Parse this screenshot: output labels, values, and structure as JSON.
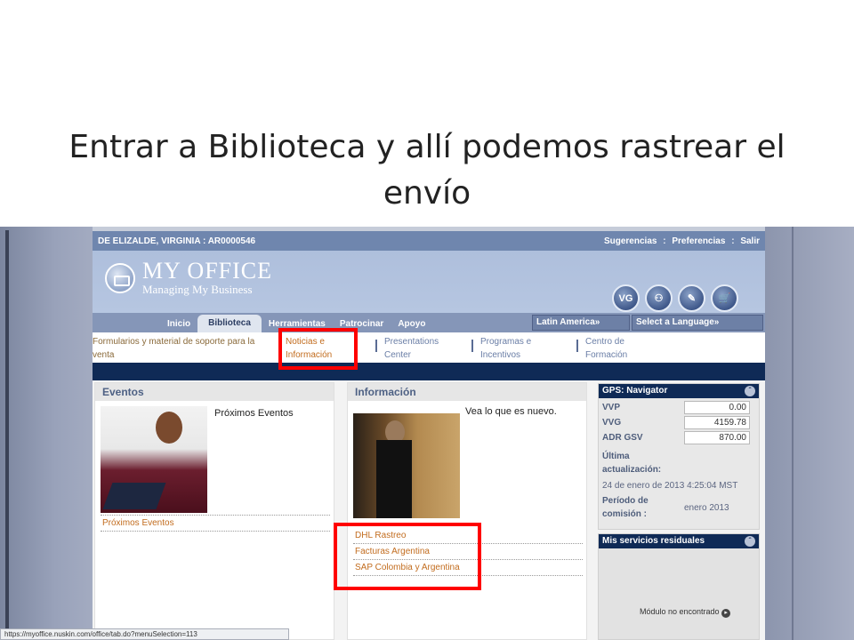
{
  "slide": {
    "title": "Entrar a Biblioteca y allí podemos rastrear el envío"
  },
  "topbar": {
    "user": "DE ELIZALDE, VIRGINIA  :  AR0000546",
    "links": [
      "Sugerencias",
      ":",
      "Preferencias",
      ":",
      "Salir"
    ]
  },
  "brand": {
    "line1": "MY OFFICE",
    "line2": "Managing My Business"
  },
  "header_icons": [
    {
      "name": "vg-icon",
      "label": "VG"
    },
    {
      "name": "people-icon",
      "label": ""
    },
    {
      "name": "tools-icon",
      "label": ""
    },
    {
      "name": "cart-icon",
      "label": ""
    }
  ],
  "nav": {
    "tabs": [
      "Inicio",
      "Biblioteca",
      "Herramientas",
      "Patrocinar",
      "Apoyo"
    ],
    "active": "Biblioteca",
    "region_select": "Latin America»",
    "language_select": "Select a Language»"
  },
  "subnav": {
    "items": [
      {
        "l1": "Formularios y material de soporte para la",
        "l2": "venta"
      },
      {
        "l1": "Noticias e",
        "l2": "Información"
      },
      {
        "l1": "Presentations",
        "l2": "Center"
      },
      {
        "l1": "Programas e",
        "l2": "Incentivos"
      },
      {
        "l1": "Centro de",
        "l2": "Formación"
      }
    ]
  },
  "eventos": {
    "header": "Eventos",
    "caption": "Próximos Eventos",
    "link": "Próximos Eventos"
  },
  "informacion": {
    "header": "Información",
    "caption": "Vea lo que es nuevo.",
    "links": [
      "DHL Rastreo",
      "Facturas Argentina",
      "SAP Colombia y Argentina"
    ]
  },
  "gps": {
    "header": "GPS: Navigator",
    "rows": [
      {
        "label": "VVP",
        "value": "0.00"
      },
      {
        "label": "VVG",
        "value": "4159.78"
      },
      {
        "label": "ADR GSV",
        "value": "870.00"
      }
    ],
    "updated_label_1": "Última",
    "updated_label_2": "actualización:",
    "updated_value": "24 de enero de 2013 4:25:04 MST",
    "period_label_1": "Período de",
    "period_label_2": "comisión :",
    "period_value": "enero 2013"
  },
  "residuales": {
    "header": "Mis servicios residuales",
    "message": "Módulo no encontrado"
  },
  "status_url": "https://myoffice.nuskin.com/office/tab.do?menuSelection=113",
  "colors": {
    "highlight": "#ff0000",
    "navy": "#0f2a56",
    "link": "#c26c1e"
  }
}
